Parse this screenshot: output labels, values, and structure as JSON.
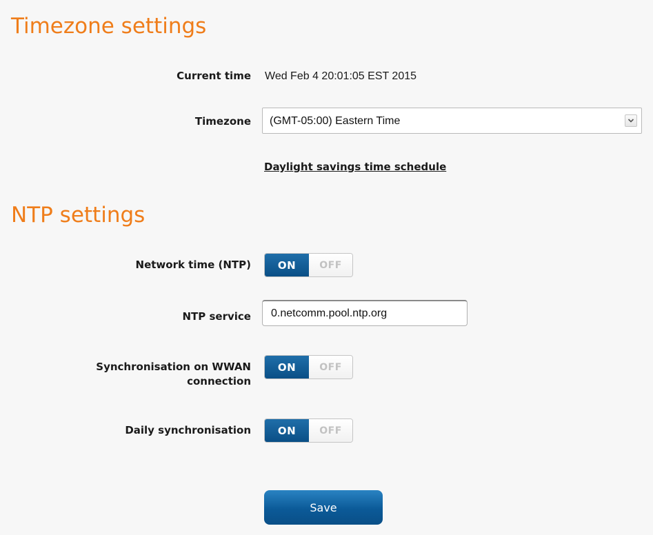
{
  "timezone_section": {
    "title": "Timezone settings",
    "current_time_label": "Current time",
    "current_time_value": "Wed Feb 4 20:01:05 EST 2015",
    "timezone_label": "Timezone",
    "timezone_selected": "(GMT-05:00) Eastern Time",
    "dst_link": "Daylight savings time schedule"
  },
  "ntp_section": {
    "title": "NTP settings",
    "network_time_label": "Network time (NTP)",
    "network_time_state": "ON",
    "ntp_service_label": "NTP service",
    "ntp_service_value": "0.netcomm.pool.ntp.org",
    "wwan_sync_label_line1": "Synchronisation on WWAN",
    "wwan_sync_label_line2": "connection",
    "wwan_sync_state": "ON",
    "daily_sync_label": "Daily synchronisation",
    "daily_sync_state": "ON"
  },
  "toggle": {
    "on_label": "ON",
    "off_label": "OFF"
  },
  "actions": {
    "save_label": "Save"
  },
  "colors": {
    "accent_orange": "#ef7d1a",
    "toggle_on_blue": "#0a4f86",
    "background": "#f7f7f7"
  },
  "icons": {
    "select_arrow": "chevron-down-icon"
  }
}
